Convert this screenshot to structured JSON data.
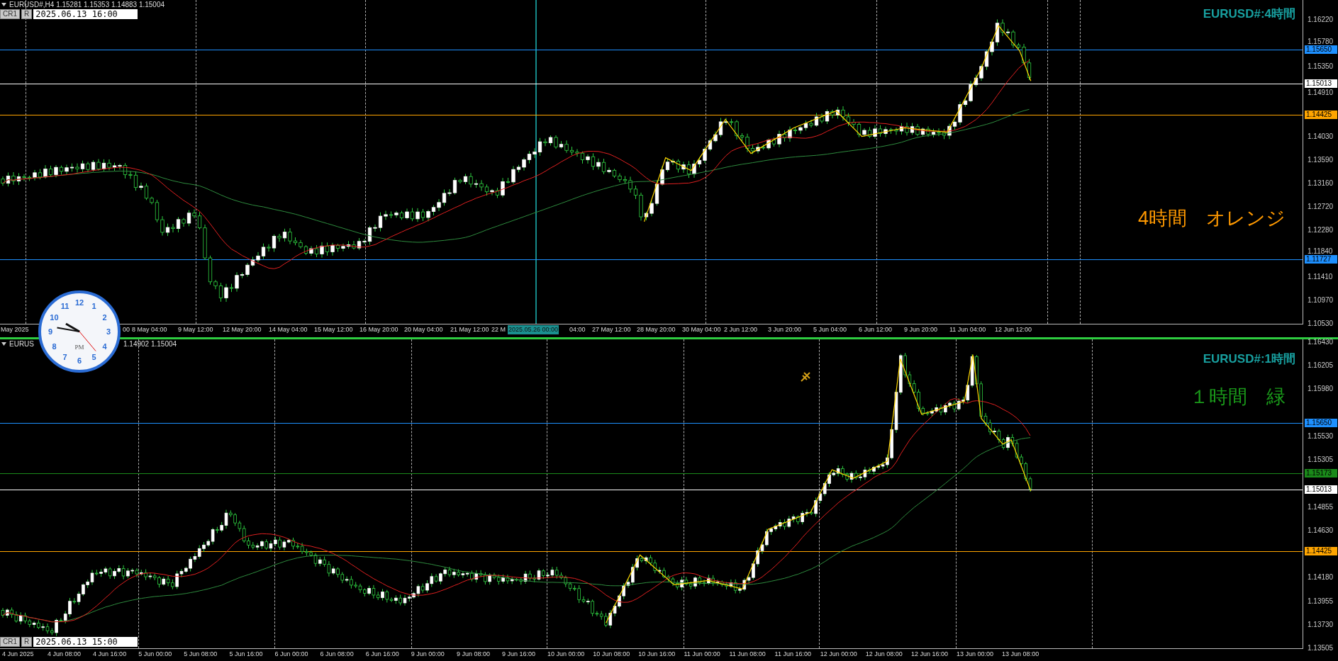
{
  "top_chart": {
    "header": {
      "symbol_line": "EURUSD#,H4  1.15281 1.15353 1.14883 1.15004",
      "buttons": [
        "CR1",
        "R"
      ],
      "datetime": "2025.06.13 16:00"
    },
    "title": "EURUSD#:4時間",
    "note": {
      "text": "4時間　オレンジ",
      "color": "#ff9900"
    },
    "price_ticks": [
      "1.16220",
      "1.15780",
      "1.15350",
      "1.14910",
      "1.14030",
      "1.13590",
      "1.13160",
      "1.12720",
      "1.12280",
      "1.11840",
      "1.11410",
      "1.10970",
      "1.10530"
    ],
    "levels": [
      {
        "price": "1.15650",
        "color": "#1e90ff"
      },
      {
        "price": "1.15013",
        "color": "#ffffff"
      },
      {
        "price": "1.14425",
        "color": "#ffa500"
      },
      {
        "price": "1.11727",
        "color": "#1e90ff"
      }
    ],
    "time_labels": [
      {
        "text": "May 2025",
        "selected": false
      },
      {
        "text": "00",
        "selected": false
      },
      {
        "text": "8 May 04:00",
        "selected": false
      },
      {
        "text": "9 May 12:00",
        "selected": false
      },
      {
        "text": "12 May 20:00",
        "selected": false
      },
      {
        "text": "14 May 04:00",
        "selected": false
      },
      {
        "text": "15 May 12:00",
        "selected": false
      },
      {
        "text": "16 May 20:00",
        "selected": false
      },
      {
        "text": "20 May 04:00",
        "selected": false
      },
      {
        "text": "21 May 12:00",
        "selected": false
      },
      {
        "text": "22 M",
        "selected": false
      },
      {
        "text": "2025.05.26 00:00",
        "selected": true
      },
      {
        "text": "04:00",
        "selected": false
      },
      {
        "text": "27 May 12:00",
        "selected": false
      },
      {
        "text": "28 May 20:00",
        "selected": false
      },
      {
        "text": "30 May 04:00",
        "selected": false
      },
      {
        "text": "2 Jun 12:00",
        "selected": false
      },
      {
        "text": "3 Jun 20:00",
        "selected": false
      },
      {
        "text": "5 Jun 04:00",
        "selected": false
      },
      {
        "text": "6 Jun 12:00",
        "selected": false
      },
      {
        "text": "9 Jun 20:00",
        "selected": false
      },
      {
        "text": "11 Jun 04:00",
        "selected": false
      },
      {
        "text": "12 Jun 12:00",
        "selected": false
      }
    ]
  },
  "bottom_chart": {
    "header": {
      "symbol_start": "EURUS",
      "symbol_end": "1.14902 1.15004",
      "buttons": [
        "CR1",
        "R"
      ],
      "datetime": "2025.06.13 15:00"
    },
    "title": "EURUSD#:1時間",
    "note": {
      "text": "１時間　緑",
      "color": "#1a9a1a"
    },
    "price_ticks": [
      "1.16430",
      "1.16205",
      "1.15980",
      "1.15530",
      "1.15305",
      "1.14855",
      "1.14630",
      "1.14180",
      "1.13955",
      "1.13730",
      "1.13505"
    ],
    "levels": [
      {
        "price": "1.15650",
        "color": "#1e90ff"
      },
      {
        "price": "1.15173",
        "color": "#1a8a1a"
      },
      {
        "price": "1.15013",
        "color": "#ffffff"
      },
      {
        "price": "1.14425",
        "color": "#ffa500"
      }
    ],
    "time_labels": [
      "4 Jun 2025",
      "4 Jun 08:00",
      "4 Jun 16:00",
      "5 Jun 00:00",
      "5 Jun 08:00",
      "5 Jun 16:00",
      "6 Jun 00:00",
      "6 Jun 08:00",
      "6 Jun 16:00",
      "9 Jun 00:00",
      "9 Jun 08:00",
      "9 Jun 16:00",
      "10 Jun 00:00",
      "10 Jun 08:00",
      "10 Jun 16:00",
      "11 Jun 00:00",
      "11 Jun 08:00",
      "11 Jun 16:00",
      "12 Jun 00:00",
      "12 Jun 08:00",
      "12 Jun 16:00",
      "13 Jun 00:00",
      "13 Jun 08:00"
    ]
  },
  "clock": {
    "numerals": [
      "12",
      "1",
      "2",
      "3",
      "4",
      "5",
      "6",
      "7",
      "8",
      "9",
      "10",
      "11"
    ],
    "label": "PM"
  }
}
